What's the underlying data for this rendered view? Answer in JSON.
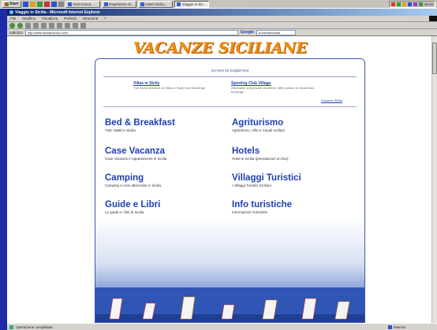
{
  "taskbar": {
    "start_label": "Start",
    "quick_launch_colors": [
      "#2a56c6",
      "#e0a020",
      "#3a9a3a",
      "#c33",
      "#2a56c6",
      "#888"
    ],
    "tasks": [
      {
        "label": "Visit Conca...",
        "active": false
      },
      {
        "label": "Esperienze di...",
        "active": false
      },
      {
        "label": "Hotel Sicilia...",
        "active": false
      },
      {
        "label": "Viaggio in Sic...",
        "active": true
      }
    ],
    "tray_colors": [
      "#e33",
      "#2a2",
      "#e0a020",
      "#2a56c6",
      "#a3c",
      "#3a9a3a"
    ],
    "clock": "18:46"
  },
  "browser": {
    "title": "Viaggio in Sicilia - Microsoft Internet Explorer",
    "menu": [
      "File",
      "Modifica",
      "Visualizza",
      "Preferiti",
      "Strumenti",
      "?"
    ],
    "address_label": "Indirizzo",
    "address_value": "http://www.siciliandoors.com/",
    "google_label": "Google",
    "google_query": "bookmarksicilia",
    "status_text": "Operazione completata",
    "zone_text": "Internet"
  },
  "site": {
    "title": "VACANZE SICILIANE",
    "english_link": "Go here for English text",
    "features": [
      {
        "title": "Villas in Sicily",
        "desc": "The finest selection of Villas in Sicily from Bookings"
      },
      {
        "title": "Sporting Club Village",
        "desc": "Affordable and private residence offers peace & residences, bookings"
      }
    ],
    "more_link": "Vacanze Sicilia",
    "categories": [
      {
        "title": "Bed & Breakfast",
        "desc": "Tutti i B&B in Sicilia"
      },
      {
        "title": "Agriturismo",
        "desc": "Agriturismo, Ville e Casali siciliani"
      },
      {
        "title": "Case Vacanza",
        "desc": "Case Vacanza e Appartamenti in Sicilia"
      },
      {
        "title": "Hotels",
        "desc": "Hotel in Sicilia (prenotazioni on line)"
      },
      {
        "title": "Camping",
        "desc": "Camping e Aree attrezzate in Sicilia"
      },
      {
        "title": "Villaggi Turistici",
        "desc": "I Villaggi Turistici Siciliani"
      },
      {
        "title": "Guide e Libri",
        "desc": "Le guide e i libri di Sicilia"
      },
      {
        "title": "Info turistiche",
        "desc": "Informazioni Turistiche"
      }
    ]
  },
  "colors": {
    "desktop": "#1d2ba8",
    "title_orange": "#f08a12",
    "link_blue": "#1e3fb0"
  }
}
